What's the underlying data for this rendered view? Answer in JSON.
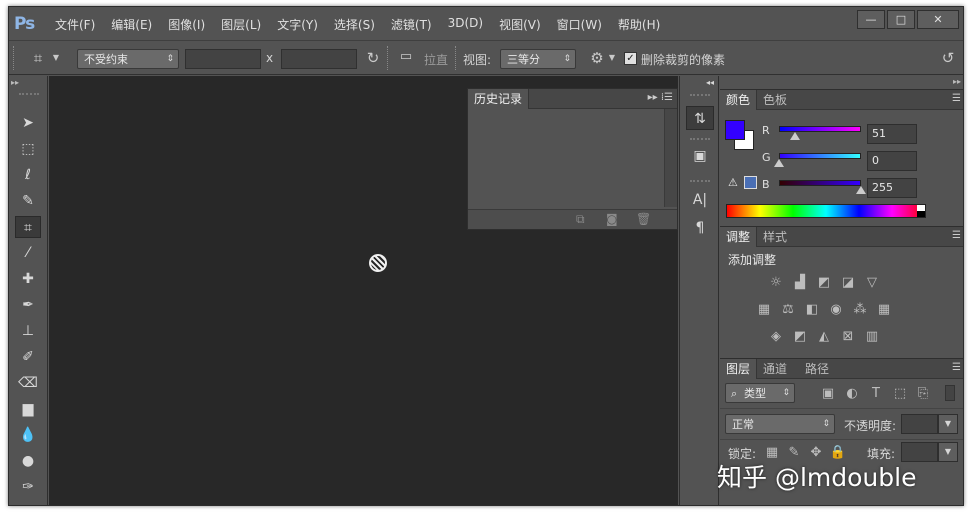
{
  "app": {
    "logo": "Ps"
  },
  "menu": [
    "文件(F)",
    "编辑(E)",
    "图像(I)",
    "图层(L)",
    "文字(Y)",
    "选择(S)",
    "滤镜(T)",
    "3D(D)",
    "视图(V)",
    "窗口(W)",
    "帮助(H)"
  ],
  "window_controls": {
    "minimize": "—",
    "restore": "□",
    "close": "✕"
  },
  "options": {
    "ratio_select": "不受约束",
    "x_sep": "x",
    "straighten_label": "拉直",
    "view_label": "视图:",
    "view_select": "三等分",
    "delete_pixels_label": "删除裁剪的像素",
    "delete_pixels_checked": true
  },
  "history": {
    "tab": "历史记录"
  },
  "color_panel": {
    "tabs": [
      "颜色",
      "色板"
    ],
    "channels": [
      {
        "label": "R",
        "value": "51",
        "fraction": 0.2
      },
      {
        "label": "G",
        "value": "0",
        "fraction": 0.0
      },
      {
        "label": "B",
        "value": "255",
        "fraction": 1.0
      }
    ],
    "foreground": "#3300ff",
    "background": "#ffffff"
  },
  "adjust_panel": {
    "tabs": [
      "调整",
      "样式"
    ],
    "heading": "添加调整"
  },
  "layers_panel": {
    "tabs": [
      "图层",
      "通道",
      "路径"
    ],
    "filter_select": "类型",
    "blend_select": "正常",
    "opacity_label": "不透明度:",
    "lock_label": "锁定:",
    "fill_label": "填充:"
  },
  "watermark": "知乎 @lmdouble"
}
